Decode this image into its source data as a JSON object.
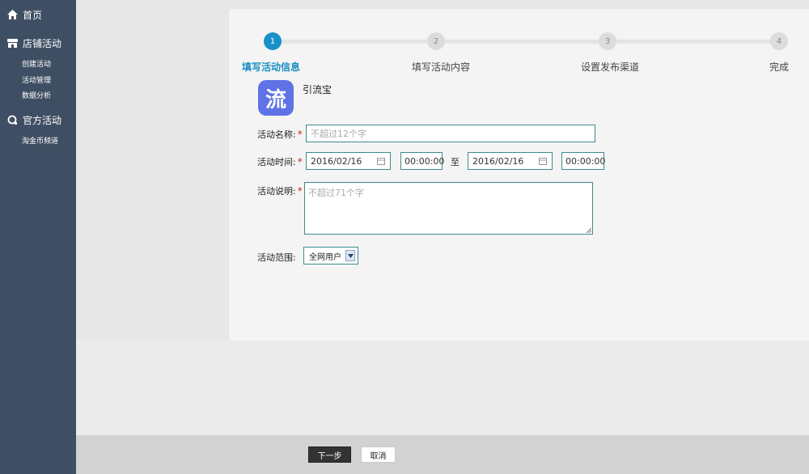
{
  "sidebar": {
    "home": {
      "label": "首页",
      "icon": "home-icon"
    },
    "store": {
      "label": "店铺活动",
      "icon": "store-icon",
      "items": [
        "创建活动",
        "活动管理",
        "数据分析"
      ]
    },
    "official": {
      "label": "官方活动",
      "icon": "official-icon",
      "items": [
        "淘金币频道"
      ]
    }
  },
  "stepper": {
    "active_color": "#1891c9",
    "steps": [
      {
        "number": "1",
        "label": "填写活动信息"
      },
      {
        "number": "2",
        "label": "填写活动内容"
      },
      {
        "number": "3",
        "label": "设置发布渠道"
      },
      {
        "number": "4",
        "label": "完成"
      }
    ]
  },
  "app": {
    "icon_char": "流",
    "name": "引流宝",
    "icon_color": "#5f73e5"
  },
  "form": {
    "name_label": "活动名称:",
    "name_placeholder": "不超过12个字",
    "time_label": "活动时间:",
    "start_date": "2016/02/16",
    "start_time": "00:00:00",
    "to_label": "至",
    "end_date": "2016/02/16",
    "end_time": "00:00:00",
    "desc_label": "活动说明:",
    "desc_placeholder": "不超过71个字",
    "scope_label": "活动范围:",
    "scope_value": "全网用户",
    "required_mark": "*"
  },
  "buttons": {
    "next": "下一步",
    "cancel": "取消"
  }
}
